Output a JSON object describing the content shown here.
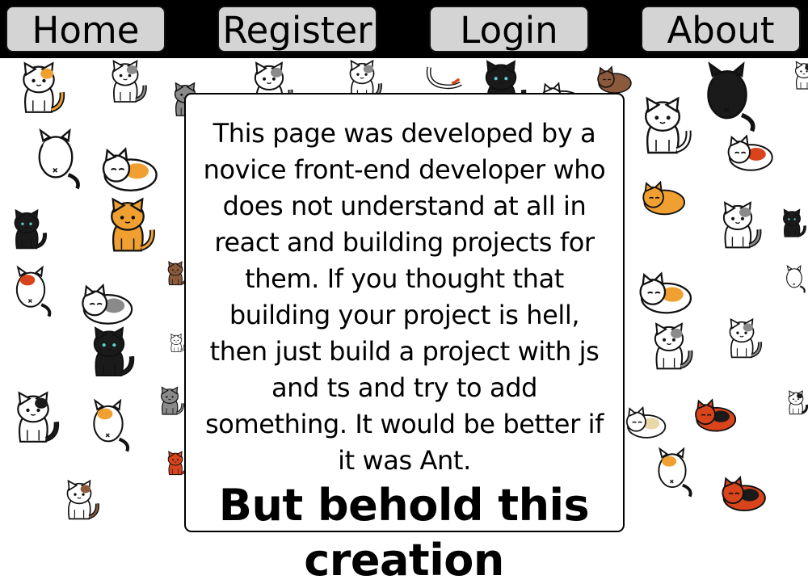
{
  "nav": {
    "home": "Home",
    "register": "Register",
    "login": "Login",
    "about": "About"
  },
  "card": {
    "body": "This page was developed by a novice front-end developer who does not understand at all in react and building projects for them. If you thought that building your project is hell, then just build a project with js and ts and try to add something. It would be better if it was Ant.",
    "headline": "But behold this creation"
  },
  "colors": {
    "nav_background": "#000000",
    "nav_button": "#d4d4d4",
    "card_background": "#ffffff",
    "card_border": "#000000",
    "cat_orange": "#f0a030",
    "cat_gray": "#8a8a8a",
    "cat_black": "#1a1a1a",
    "cat_calico_red": "#d9441c"
  },
  "background_pattern": {
    "icon": "cat-sticker-icon",
    "description_visible": false
  }
}
